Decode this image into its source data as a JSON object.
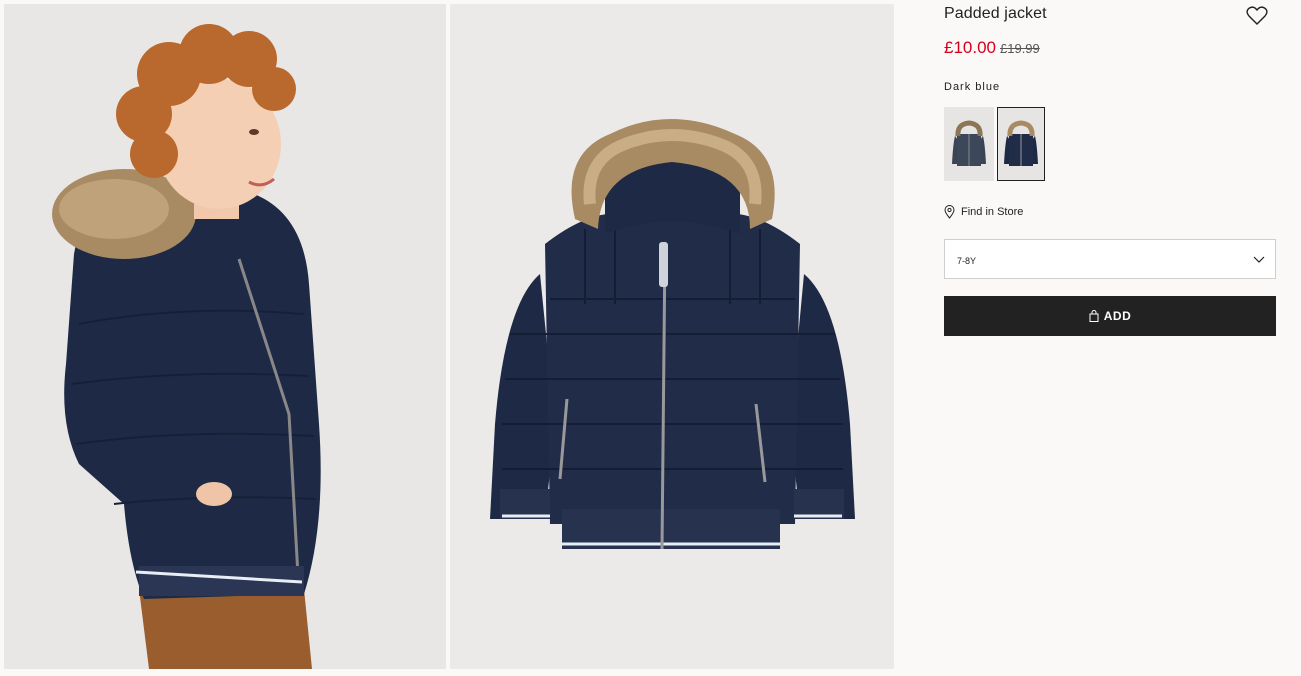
{
  "product": {
    "title": "Padded jacket",
    "price_now": "£10.00",
    "price_old": "£19.99",
    "price_color": "#d6001c",
    "color_label": "Dark blue",
    "swatches": [
      {
        "name": "jacket-swatch-grey",
        "selected": false
      },
      {
        "name": "jacket-swatch-dark-blue",
        "selected": true
      }
    ],
    "find_store_label": "Find in Store",
    "size_value": "7-8Y",
    "add_label": "ADD"
  },
  "icons": {
    "favorite": "heart-icon",
    "store": "location-pin-icon",
    "dropdown": "chevron-down-icon",
    "bag": "shopping-bag-icon"
  },
  "colors": {
    "jacket": "#1e2a45",
    "button": "#222222",
    "background": "#faf9f8"
  }
}
